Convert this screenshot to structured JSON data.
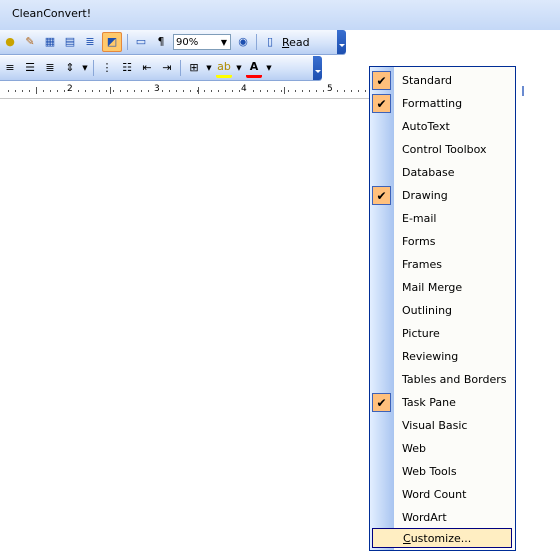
{
  "window": {
    "title": "CleanConvert!"
  },
  "standard_toolbar": {
    "zoom": "90%",
    "read_label": "Read",
    "read_accel": "R",
    "icons": [
      "research-icon",
      "insert-hyperlink-icon",
      "tables-borders-icon",
      "insert-table-icon",
      "columns-icon",
      "drawing-icon",
      "document-map-icon",
      "show-formatting-icon",
      "zoom-dropdown",
      "help-icon",
      "read-icon"
    ]
  },
  "formatting_toolbar": {
    "icons": [
      "align-right-icon",
      "justify-icon",
      "line-spacing-icon",
      "numbering-icon",
      "bullets-icon",
      "decrease-indent-icon",
      "increase-indent-icon",
      "borders-icon",
      "highlight-icon",
      "font-color-icon"
    ]
  },
  "ruler": {
    "numbers": [
      "2",
      "3",
      "4",
      "5"
    ]
  },
  "menu": {
    "items": [
      {
        "label": "Standard",
        "checked": true
      },
      {
        "label": "Formatting",
        "checked": true
      },
      {
        "label": "AutoText",
        "checked": false
      },
      {
        "label": "Control Toolbox",
        "checked": false
      },
      {
        "label": "Database",
        "checked": false
      },
      {
        "label": "Drawing",
        "checked": true
      },
      {
        "label": "E-mail",
        "checked": false
      },
      {
        "label": "Forms",
        "checked": false
      },
      {
        "label": "Frames",
        "checked": false
      },
      {
        "label": "Mail Merge",
        "checked": false
      },
      {
        "label": "Outlining",
        "checked": false
      },
      {
        "label": "Picture",
        "checked": false
      },
      {
        "label": "Reviewing",
        "checked": false
      },
      {
        "label": "Tables and Borders",
        "checked": false
      },
      {
        "label": "Task Pane",
        "checked": true
      },
      {
        "label": "Visual Basic",
        "checked": false
      },
      {
        "label": "Web",
        "checked": false
      },
      {
        "label": "Web Tools",
        "checked": false
      },
      {
        "label": "Word Count",
        "checked": false
      },
      {
        "label": "WordArt",
        "checked": false
      }
    ],
    "customize_accel": "C",
    "customize_rest": "ustomize..."
  },
  "colors": {
    "menu_border": "#002d96",
    "check_bg": "#ffc07c",
    "toolbar_blue": "#c4d8f7",
    "highlight": "#ffeec2"
  }
}
